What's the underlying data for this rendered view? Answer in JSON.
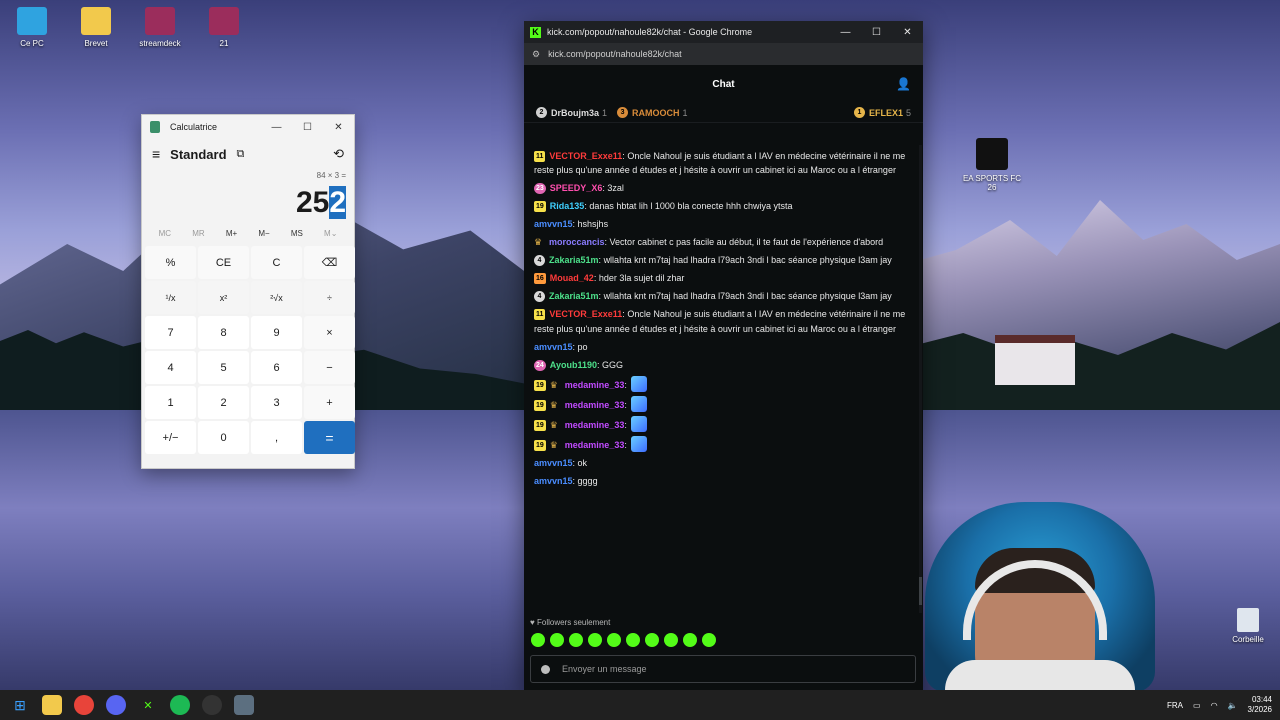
{
  "desktop": {
    "icons": [
      {
        "label": "Ce PC",
        "color": "#2fa3e0"
      },
      {
        "label": "Brevet",
        "color": "#f2c94c"
      },
      {
        "label": "streamdeck",
        "color": "#9b2d5c"
      },
      {
        "label": "21",
        "color": "#9b2d5c"
      }
    ],
    "right_icons": [
      {
        "label": "EA SPORTS FC 26"
      }
    ],
    "trash_label": "Corbeille"
  },
  "calculator": {
    "title": "Calculatrice",
    "mode": "Standard",
    "expression": "84 × 3 =",
    "result_main": "25",
    "result_selected": "2",
    "memory": [
      "MC",
      "MR",
      "M+",
      "M−",
      "MS",
      "M⌄"
    ],
    "keys": [
      "%",
      "CE",
      "C",
      "⌫",
      "¹/x",
      "x²",
      "²√x",
      "÷",
      "7",
      "8",
      "9",
      "×",
      "4",
      "5",
      "6",
      "−",
      "1",
      "2",
      "3",
      "+",
      "+/−",
      "0",
      ",",
      "="
    ]
  },
  "browser": {
    "window_title": "kick.com/popout/nahoule82k/chat - Google Chrome",
    "url": "kick.com/popout/nahoule82k/chat"
  },
  "chat": {
    "header": "Chat",
    "top_gifters": [
      {
        "name": "DrBoujm3a",
        "count": "1",
        "rank": "2",
        "color": "#cfcfcf"
      },
      {
        "name": "RAMOOCH",
        "count": "1",
        "rank": "3",
        "color": "#d98c3a"
      },
      {
        "name": "EFLEX1",
        "count": "5",
        "rank": "1",
        "color": "#e6b54a"
      }
    ],
    "messages": [
      {
        "badge": "11",
        "badge_type": "yellow",
        "user": "VECTOR_Exxe11",
        "color": "#ff3b3b",
        "text": "Oncle Nahoul je suis étudiant a l IAV en médecine vétérinaire il ne me reste plus qu'une année d études et j hésite à ouvrir un cabinet ici au Maroc ou a l étranger"
      },
      {
        "badge": "23",
        "badge_type": "pink",
        "user": "SPEEDY_X6",
        "color": "#ff4fae",
        "text": "3zal"
      },
      {
        "badge": "19",
        "badge_type": "yellow",
        "user": "Rida135",
        "color": "#3fd0ff",
        "text": "danas hbtat lih l 1000 bla conecte hhh chwiya ytsta"
      },
      {
        "badge": "",
        "badge_type": "none",
        "user": "amvvn15",
        "color": "#4a8dff",
        "text": "hshsjhs"
      },
      {
        "badge": "",
        "badge_type": "crown",
        "user": "moroccancis",
        "color": "#8a7cff",
        "text": "Vector cabinet c pas facile au début, il te faut de l'expérience d'abord"
      },
      {
        "badge": "4",
        "badge_type": "grey",
        "user": "Zakaria51m",
        "color": "#4de08a",
        "text": "wllahta knt m7taj had lhadra l79ach 3ndi l bac séance physique l3am jay"
      },
      {
        "badge": "16",
        "badge_type": "orange",
        "user": "Mouad_42",
        "color": "#ff3b3b",
        "text": "hder 3la sujet dil zhar"
      },
      {
        "badge": "4",
        "badge_type": "grey",
        "user": "Zakaria51m",
        "color": "#4de08a",
        "text": "wllahta knt m7taj had lhadra l79ach 3ndi l bac séance physique l3am jay"
      },
      {
        "badge": "11",
        "badge_type": "yellow",
        "user": "VECTOR_Exxe11",
        "color": "#ff3b3b",
        "text": "Oncle Nahoul je suis étudiant a l IAV en médecine vétérinaire il ne me reste plus qu'une année d études et j hésite à ouvrir un cabinet ici au Maroc ou a l étranger"
      },
      {
        "badge": "",
        "badge_type": "none",
        "user": "amvvn15",
        "color": "#4a8dff",
        "text": "po"
      },
      {
        "badge": "24",
        "badge_type": "pink",
        "user": "Ayoub1190",
        "color": "#4de08a",
        "text": "GGG"
      },
      {
        "badge": "19",
        "badge_type": "yellow-crown",
        "user": "medamine_33",
        "color": "#c14bff",
        "text": "",
        "emote": true
      },
      {
        "badge": "19",
        "badge_type": "yellow-crown",
        "user": "medamine_33",
        "color": "#c14bff",
        "text": "",
        "emote": true
      },
      {
        "badge": "19",
        "badge_type": "yellow-crown",
        "user": "medamine_33",
        "color": "#c14bff",
        "text": "",
        "emote": true
      },
      {
        "badge": "19",
        "badge_type": "yellow-crown",
        "user": "medamine_33",
        "color": "#c14bff",
        "text": "",
        "emote": true
      },
      {
        "badge": "",
        "badge_type": "none",
        "user": "amvvn15",
        "color": "#4a8dff",
        "text": "ok"
      },
      {
        "badge": "",
        "badge_type": "none",
        "user": "amvvn15",
        "color": "#4a8dff",
        "text": "gggg"
      }
    ],
    "followers_only": "Followers seulement",
    "input_placeholder": "Envoyer un message"
  },
  "taskbar": {
    "language": "FRA",
    "time": "03:44",
    "date": "3/2026"
  }
}
